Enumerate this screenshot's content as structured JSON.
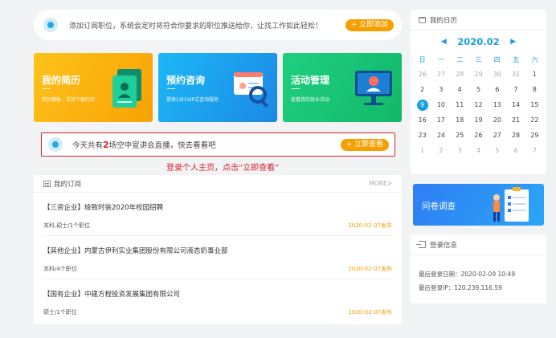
{
  "subscribe_banner": {
    "text": "添加订阅职位，系统会定时将符合你要求的职位推送给你，让找工作如此轻松！",
    "button": "+ 立即添加"
  },
  "tiles": [
    {
      "title": "我的简历",
      "desc": "简历模板，支持下载打印",
      "color": "#f7a203"
    },
    {
      "title": "预约咨询",
      "desc": "提供1对1VIP式咨询服务",
      "color": "#1c88e6"
    },
    {
      "title": "活动管理",
      "desc": "查看我的就业活动",
      "color": "#12b868"
    }
  ],
  "live_notice": {
    "prefix": "今天共有",
    "count": "2",
    "suffix": "场空中宣讲会直播，快去看看吧",
    "button": "+ 立即查看"
  },
  "instruction": "登录个人主页，点击“立即查看”",
  "subscriptions": {
    "title": "我的订阅",
    "more": "MORE>",
    "items": [
      {
        "name": "【三资企业】绫致时装2020年校园招聘",
        "meta": "本科,硕士/1个职位",
        "date": "2020-02-07发布"
      },
      {
        "name": "【其他企业】内蒙古伊利实业集团股份有限公司液态奶事业部",
        "meta": "本科/4个职位",
        "date": "2020-02-07发布"
      },
      {
        "name": "【国有企业】中建方程投资发展集团有限公司",
        "meta": "硕士/1个职位",
        "date": "2020-02-07发布"
      }
    ]
  },
  "calendar": {
    "title": "我的日历",
    "month": "2020.02",
    "weekdays": [
      "日",
      "一",
      "二",
      "三",
      "四",
      "五",
      "六"
    ],
    "rows": [
      [
        "26",
        "27",
        "28",
        "29",
        "30",
        "31",
        "1"
      ],
      [
        "2",
        "3",
        "4",
        "5",
        "6",
        "7",
        "8"
      ],
      [
        "9",
        "10",
        "11",
        "12",
        "13",
        "14",
        "15"
      ],
      [
        "16",
        "17",
        "18",
        "19",
        "20",
        "21",
        "22"
      ],
      [
        "23",
        "24",
        "25",
        "26",
        "27",
        "28",
        "29"
      ],
      [
        "1",
        "2",
        "3",
        "4",
        "5",
        "6",
        "7"
      ]
    ],
    "today": "9",
    "accent": "#1a9fe0"
  },
  "survey": {
    "title": "问卷调查"
  },
  "login_info": {
    "title": "登录信息",
    "last_date_label": "最后登录日期：",
    "last_date": "2020-02-09 10:49",
    "last_ip_label": "最后登录IP：",
    "last_ip": "120.239.116.59"
  }
}
